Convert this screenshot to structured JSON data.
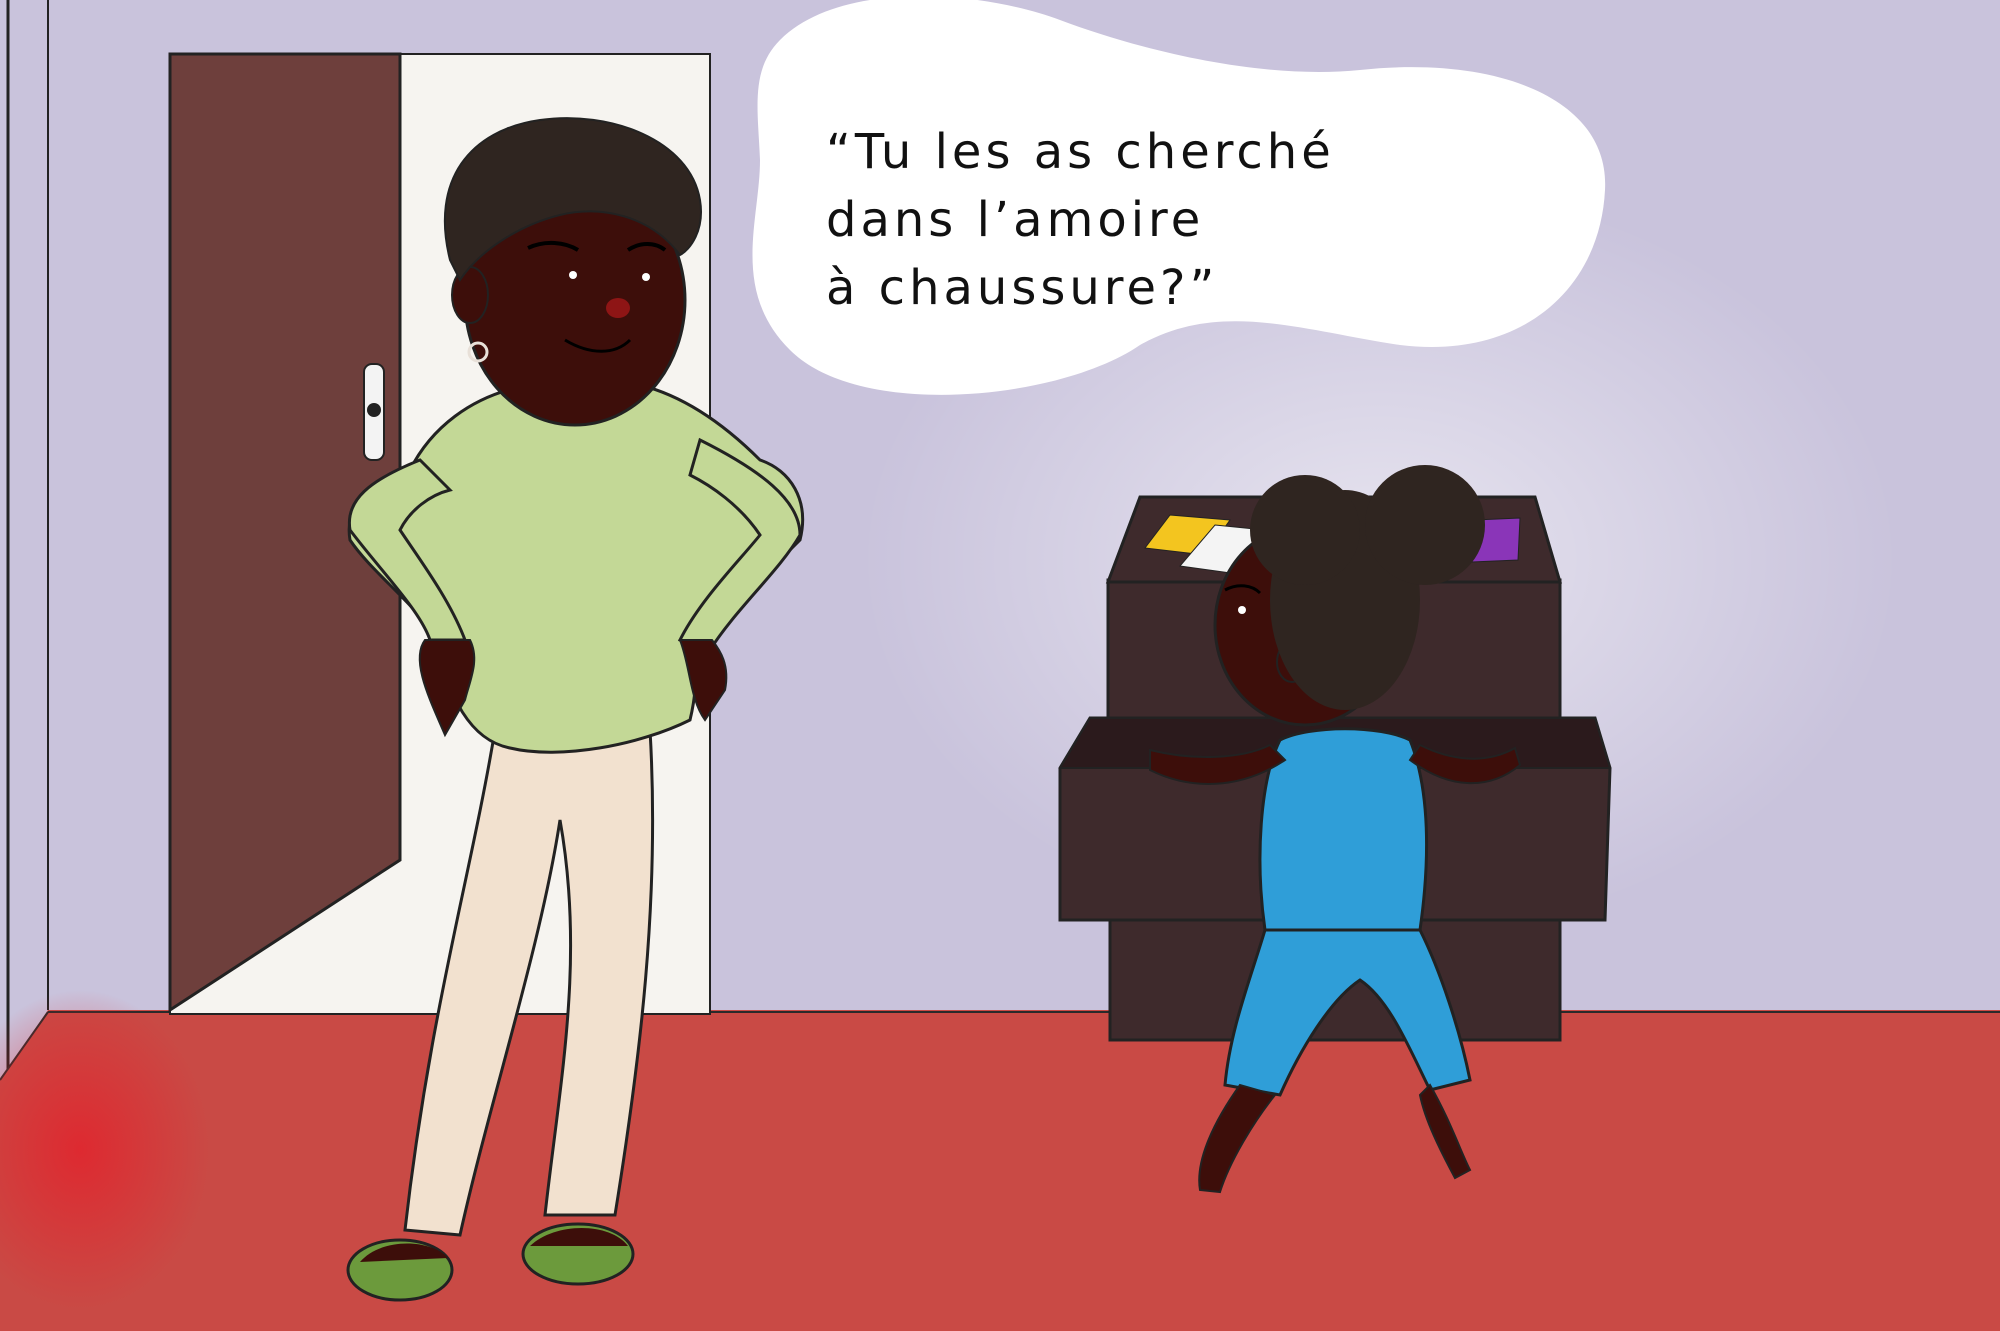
{
  "illustration": {
    "speech_bubble": {
      "lines": [
        "“Tu les as cherché",
        "dans l’amoire",
        "à chaussure?”"
      ]
    },
    "colors": {
      "wall": "#c9c3dc",
      "floor": "#c94a45",
      "door": "#6e3f3c",
      "skin": "#3d0e0a",
      "hair": "#2f2520",
      "sweater": "#c3d896",
      "pants": "#f2e1cf",
      "slippers": "#6c9a3c",
      "child_outfit": "#2f9ed8",
      "cabinet": "#3e2a2c",
      "card_yellow": "#f3c51f",
      "card_purple": "#8a35b8"
    }
  }
}
